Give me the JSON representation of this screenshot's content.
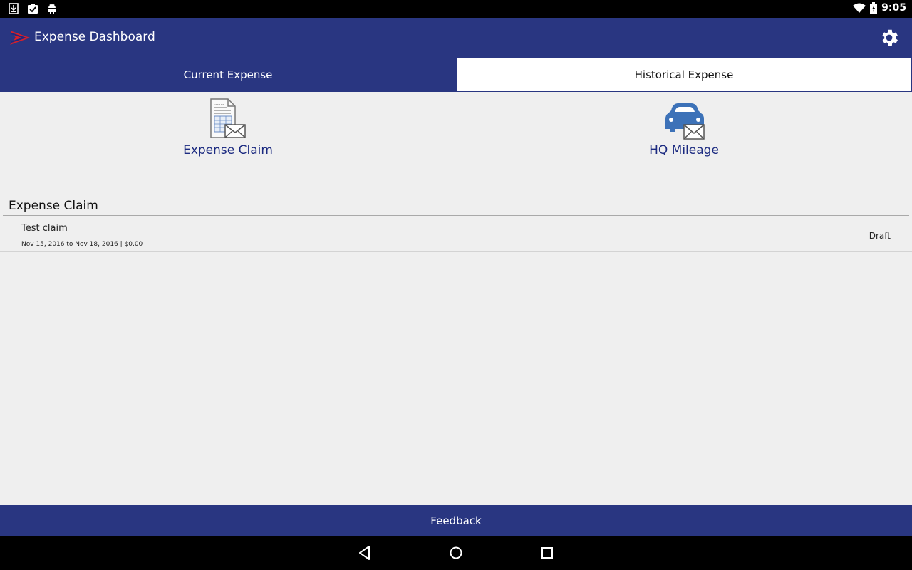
{
  "status_bar": {
    "time": "9:05",
    "icons": [
      "download-icon",
      "clipboard-check-icon",
      "android-icon",
      "wifi-icon",
      "battery-charging-icon"
    ]
  },
  "app_bar": {
    "title": "Expense Dashboard",
    "settings_icon": "gear-icon"
  },
  "tabs": [
    {
      "label": "Current Expense",
      "active": true
    },
    {
      "label": "Historical Expense",
      "active": false
    }
  ],
  "launchers": [
    {
      "label": "Expense Claim",
      "icon": "expense-claim-icon"
    },
    {
      "label": "HQ Mileage",
      "icon": "car-mail-icon"
    }
  ],
  "section": {
    "title": "Expense Claim"
  },
  "claims": [
    {
      "name": "Test claim",
      "meta": "Nov 15, 2016 to Nov 18, 2016 | $0.00",
      "status": "Draft"
    }
  ],
  "footer": {
    "feedback_label": "Feedback"
  },
  "colors": {
    "primary": "#293681",
    "link_text": "#1b2a80",
    "car_blue": "#3d72b8",
    "background": "#efefef"
  }
}
